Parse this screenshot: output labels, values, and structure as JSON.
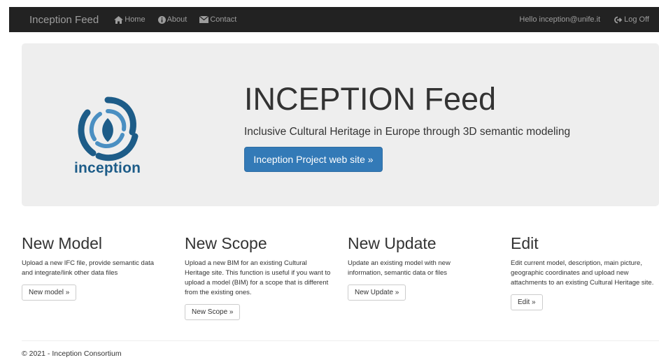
{
  "navbar": {
    "brand": "Inception Feed",
    "home": "Home",
    "about": "About",
    "contact": "Contact",
    "greeting": "Hello inception@unife.it",
    "logoff": "Log Off"
  },
  "hero": {
    "logo_text": "inception",
    "title": "INCEPTION Feed",
    "subtitle": "Inclusive Cultural Heritage in Europe through 3D semantic modeling",
    "button": "Inception Project web site »"
  },
  "columns": [
    {
      "title": "New Model",
      "desc": "Upload a new IFC file, provide semantic data and integrate/link other data files",
      "button": "New model »"
    },
    {
      "title": "New Scope",
      "desc": "Upload a new BIM for an existing Cultural Heritage site. This function is useful if you want to upload a model (BIM) for a scope that is different from the existing ones.",
      "button": "New Scope »"
    },
    {
      "title": "New Update",
      "desc": "Update an existing model with new information, semantic data or files",
      "button": "New Update »"
    },
    {
      "title": "Edit",
      "desc": "Edit current model, description, main picture, geographic coordinates and upload new attachments to an existing Cultural Heritage site.",
      "button": "Edit »"
    }
  ],
  "footer": "© 2021 - Inception Consortium",
  "colors": {
    "navbar_bg": "#222222",
    "primary": "#337ab7",
    "jumbotron_bg": "#eeeeee",
    "logo_blue": "#1d5c88"
  }
}
